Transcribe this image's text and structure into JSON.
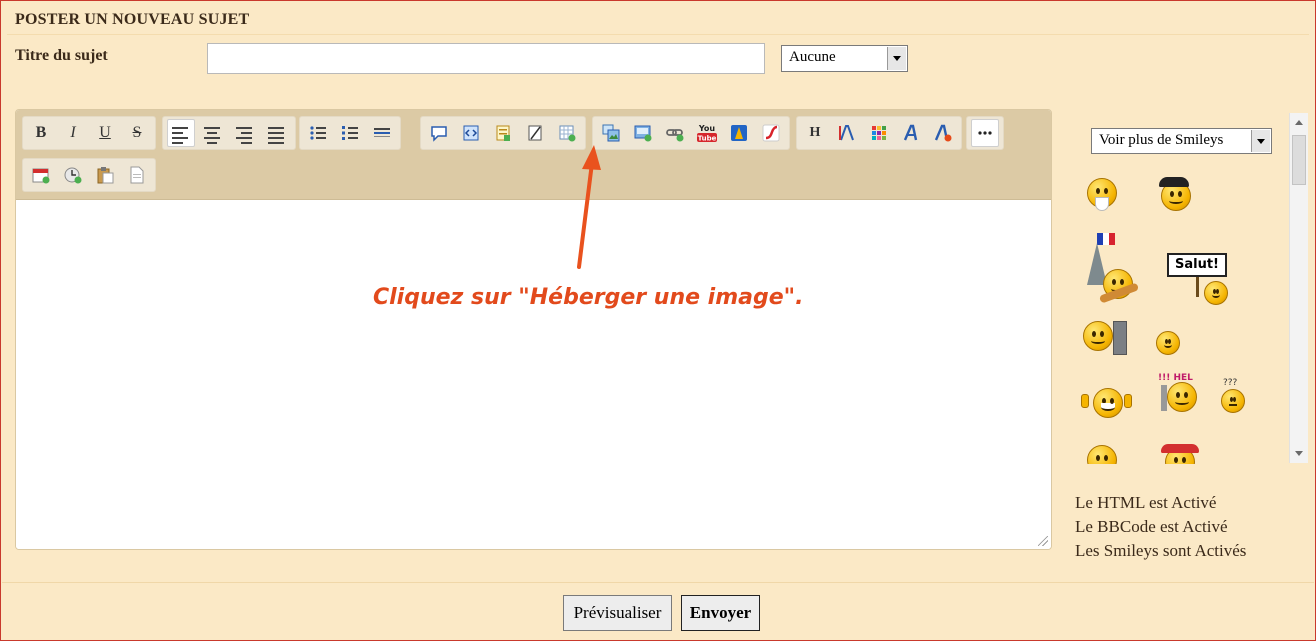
{
  "header": {
    "title": "POSTER UN NOUVEAU SUJET"
  },
  "subject": {
    "label": "Titre du sujet",
    "value": "",
    "prefix_selected": "Aucune"
  },
  "toolbar": {
    "groups": [
      [
        "bold-icon",
        "italic-icon",
        "underline-icon",
        "strikethrough-icon"
      ],
      [
        "align-left-icon",
        "align-center-icon",
        "align-right-icon",
        "justify-icon"
      ],
      [
        "bullet-list-icon",
        "numbered-list-icon",
        "horizontal-rule-icon"
      ],
      [
        "quote-icon",
        "code-icon",
        "spoiler-icon",
        "hide-icon",
        "table-icon"
      ],
      [
        "host-image-icon",
        "insert-image-icon",
        "link-icon",
        "youtube-icon",
        "dailymotion-icon",
        "flash-icon"
      ],
      [
        "header-icon",
        "font-size-icon",
        "color-icon",
        "font-face-icon",
        "text-effect-icon"
      ],
      [
        "more-icon"
      ],
      [
        "date-icon",
        "time-icon",
        "paste-icon",
        "source-icon"
      ]
    ],
    "labels": {
      "bold": "B",
      "italic": "I",
      "underline": "U",
      "strike": "S",
      "header": "H",
      "youtube_top": "You",
      "youtube_bottom": "Tube"
    }
  },
  "annotation": {
    "text": "Cliquez sur \"Héberger une image\".",
    "color": "#e24a1c"
  },
  "smileys": {
    "select_label": "Voir plus de Smileys",
    "items": [
      "smiley-old-man",
      "smiley-beret",
      "smiley-paris",
      "smiley-salut",
      "smiley-tv",
      "smiley-smile",
      "smiley-thumbs",
      "smiley-help",
      "smiley-confused",
      "smiley-hand",
      "smiley-hat"
    ],
    "salut_sign": "Salut!",
    "help_sign": "!!! HEL",
    "confused_marks": "???"
  },
  "status": {
    "html": "Le HTML est Activé",
    "bbcode": "Le BBCode est Activé",
    "smileys": "Les Smileys sont Activés"
  },
  "buttons": {
    "preview": "Prévisualiser",
    "send": "Envoyer"
  },
  "colors": {
    "background": "#fbe9c6",
    "toolbar": "#dccaa5",
    "border": "#c9392c",
    "annotation": "#e24a1c"
  }
}
